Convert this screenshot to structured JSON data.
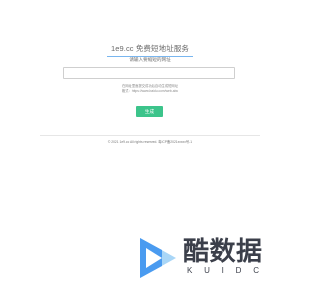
{
  "header": {
    "title": "1e9.cc 免费短地址服务"
  },
  "form": {
    "prompt": "请输入要缩短的网址",
    "url_value": "",
    "hint_line1": "在网址里面提交成功后自动生成短网址",
    "hint_line2": "格式：https://www.baidu.com/web-abc",
    "submit_label": "生成"
  },
  "footer": {
    "copyright": "© 2021 1e9.cc All rights reserved. 粤ICP备2021xxxxx号-1"
  },
  "watermark": {
    "brand": "酷数据",
    "letters": [
      "K",
      "U",
      "I",
      "D",
      "C"
    ]
  },
  "colors": {
    "accent": "#3cc48b",
    "title_underline": "#79b6ef",
    "logo_blue": "#4a9bf0",
    "logo_light": "#a9d6f7"
  }
}
